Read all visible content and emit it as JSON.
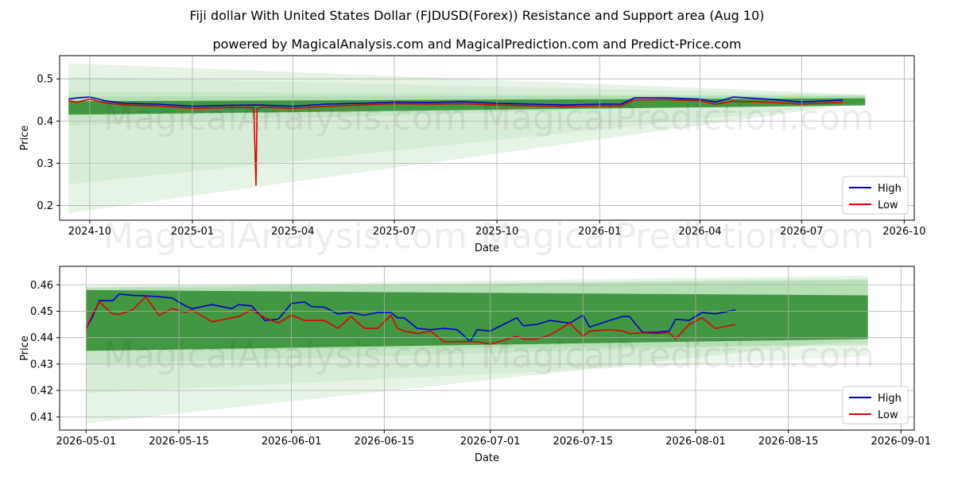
{
  "header": {
    "title": "Fiji dollar With United States Dollar (FJDUSD(Forex)) Resistance and Support area (Aug 10)",
    "subtitle": "powered by MagicalAnalysis.com and MagicalPrediction.com and Predict-Price.com"
  },
  "watermarks": [
    "MagicalAnalysis.com",
    "MagicalPrediction.com"
  ],
  "colors": {
    "high": "#0000cc",
    "low": "#dd0000",
    "band": "#2e8b2e",
    "fan": "#8fcf8f"
  },
  "chart_data": [
    {
      "type": "line",
      "xlabel": "Date",
      "ylabel": "Price",
      "xlim": [
        "2024-09-04",
        "2026-10-10"
      ],
      "ylim": [
        0.165,
        0.555
      ],
      "yticks": [
        0.2,
        0.3,
        0.4,
        0.5
      ],
      "xticks": [
        "2024-10",
        "2025-01",
        "2025-04",
        "2025-07",
        "2025-10",
        "2026-01",
        "2026-04",
        "2026-07",
        "2026-10"
      ],
      "legend": "lower-right",
      "grid": true,
      "series": [
        {
          "name": "High",
          "color": "#0000cc",
          "x": [
            "2024-09-12",
            "2024-09-20",
            "2024-10-01",
            "2024-10-15",
            "2024-11-01",
            "2024-12-01",
            "2025-01-01",
            "2025-02-01",
            "2025-03-01",
            "2025-04-01",
            "2025-05-01",
            "2025-06-01",
            "2025-07-01",
            "2025-08-01",
            "2025-09-01",
            "2025-10-01",
            "2025-11-01",
            "2025-12-01",
            "2026-01-01",
            "2026-01-20",
            "2026-02-01",
            "2026-03-01",
            "2026-04-01",
            "2026-04-15",
            "2026-05-01",
            "2026-06-01",
            "2026-07-01",
            "2026-08-07"
          ],
          "values": [
            0.452,
            0.455,
            0.457,
            0.448,
            0.442,
            0.44,
            0.435,
            0.437,
            0.438,
            0.435,
            0.44,
            0.442,
            0.445,
            0.444,
            0.446,
            0.442,
            0.44,
            0.438,
            0.44,
            0.44,
            0.455,
            0.455,
            0.452,
            0.445,
            0.457,
            0.452,
            0.445,
            0.45
          ]
        },
        {
          "name": "Low",
          "color": "#dd0000",
          "x": [
            "2024-09-12",
            "2024-09-20",
            "2024-10-01",
            "2024-10-15",
            "2024-11-01",
            "2024-12-01",
            "2025-01-01",
            "2025-02-01",
            "2025-02-25",
            "2025-02-27",
            "2025-02-28",
            "2025-03-05",
            "2025-04-01",
            "2025-05-01",
            "2025-06-01",
            "2025-07-01",
            "2025-08-01",
            "2025-09-01",
            "2025-10-01",
            "2025-11-01",
            "2025-12-01",
            "2026-01-01",
            "2026-01-20",
            "2026-02-01",
            "2026-03-01",
            "2026-04-01",
            "2026-04-15",
            "2026-05-01",
            "2026-06-01",
            "2026-07-01",
            "2026-08-07"
          ],
          "values": [
            0.448,
            0.445,
            0.452,
            0.443,
            0.438,
            0.436,
            0.43,
            0.432,
            0.432,
            0.248,
            0.43,
            0.433,
            0.43,
            0.435,
            0.438,
            0.441,
            0.44,
            0.441,
            0.438,
            0.436,
            0.434,
            0.436,
            0.436,
            0.45,
            0.451,
            0.448,
            0.44,
            0.447,
            0.445,
            0.44,
            0.445
          ]
        }
      ]
    },
    {
      "type": "line",
      "xlabel": "Date",
      "ylabel": "Price",
      "xlim": [
        "2026-04-27",
        "2026-09-03"
      ],
      "ylim": [
        0.405,
        0.467
      ],
      "yticks": [
        0.41,
        0.42,
        0.43,
        0.44,
        0.45,
        0.46
      ],
      "xticks": [
        "2026-05-01",
        "2026-05-15",
        "2026-06-01",
        "2026-06-15",
        "2026-07-01",
        "2026-07-15",
        "2026-08-01",
        "2026-08-15",
        "2026-09-01"
      ],
      "legend": "lower-right",
      "grid": true,
      "series": [
        {
          "name": "High",
          "color": "#0000cc",
          "x": [
            "2026-05-01",
            "2026-05-02",
            "2026-05-03",
            "2026-05-05",
            "2026-05-06",
            "2026-05-08",
            "2026-05-10",
            "2026-05-12",
            "2026-05-14",
            "2026-05-16",
            "2026-05-17",
            "2026-05-20",
            "2026-05-23",
            "2026-05-24",
            "2026-05-26",
            "2026-05-28",
            "2026-05-30",
            "2026-06-01",
            "2026-06-03",
            "2026-06-04",
            "2026-06-06",
            "2026-06-08",
            "2026-06-10",
            "2026-06-12",
            "2026-06-14",
            "2026-06-16",
            "2026-06-17",
            "2026-06-18",
            "2026-06-20",
            "2026-06-22",
            "2026-06-24",
            "2026-06-26",
            "2026-06-28",
            "2026-06-29",
            "2026-07-01",
            "2026-07-03",
            "2026-07-05",
            "2026-07-06",
            "2026-07-08",
            "2026-07-10",
            "2026-07-13",
            "2026-07-15",
            "2026-07-16",
            "2026-07-19",
            "2026-07-21",
            "2026-07-22",
            "2026-07-24",
            "2026-07-26",
            "2026-07-28",
            "2026-07-29",
            "2026-07-31",
            "2026-08-02",
            "2026-08-04",
            "2026-08-07"
          ],
          "values": [
            0.4435,
            0.448,
            0.454,
            0.454,
            0.4565,
            0.456,
            0.4558,
            0.4555,
            0.455,
            0.452,
            0.451,
            0.4525,
            0.451,
            0.4525,
            0.452,
            0.4465,
            0.447,
            0.453,
            0.4535,
            0.4518,
            0.4515,
            0.449,
            0.4495,
            0.4485,
            0.4495,
            0.4495,
            0.4475,
            0.4475,
            0.4435,
            0.443,
            0.4435,
            0.443,
            0.4385,
            0.443,
            0.4425,
            0.445,
            0.4475,
            0.4445,
            0.445,
            0.4465,
            0.4455,
            0.4485,
            0.444,
            0.4465,
            0.448,
            0.448,
            0.442,
            0.442,
            0.4425,
            0.447,
            0.4465,
            0.4495,
            0.449,
            0.4505
          ]
        },
        {
          "name": "Low",
          "color": "#dd0000",
          "x": [
            "2026-05-01",
            "2026-05-02",
            "2026-05-03",
            "2026-05-05",
            "2026-05-06",
            "2026-05-08",
            "2026-05-10",
            "2026-05-12",
            "2026-05-14",
            "2026-05-16",
            "2026-05-17",
            "2026-05-20",
            "2026-05-23",
            "2026-05-24",
            "2026-05-26",
            "2026-05-28",
            "2026-05-30",
            "2026-06-01",
            "2026-06-03",
            "2026-06-04",
            "2026-06-06",
            "2026-06-08",
            "2026-06-10",
            "2026-06-12",
            "2026-06-14",
            "2026-06-16",
            "2026-06-17",
            "2026-06-18",
            "2026-06-20",
            "2026-06-22",
            "2026-06-24",
            "2026-06-26",
            "2026-06-28",
            "2026-06-29",
            "2026-07-01",
            "2026-07-03",
            "2026-07-05",
            "2026-07-06",
            "2026-07-08",
            "2026-07-10",
            "2026-07-13",
            "2026-07-15",
            "2026-07-16",
            "2026-07-19",
            "2026-07-21",
            "2026-07-22",
            "2026-07-24",
            "2026-07-26",
            "2026-07-28",
            "2026-07-29",
            "2026-07-31",
            "2026-08-02",
            "2026-08-04",
            "2026-08-07"
          ],
          "values": [
            0.4435,
            0.449,
            0.4535,
            0.449,
            0.4488,
            0.4505,
            0.4555,
            0.4485,
            0.451,
            0.4495,
            0.4505,
            0.446,
            0.4475,
            0.448,
            0.4505,
            0.4475,
            0.4455,
            0.4485,
            0.4465,
            0.4465,
            0.4465,
            0.4435,
            0.448,
            0.4435,
            0.4435,
            0.4485,
            0.4435,
            0.4425,
            0.4415,
            0.4425,
            0.4385,
            0.4385,
            0.4385,
            0.4385,
            0.4375,
            0.439,
            0.4405,
            0.4395,
            0.4395,
            0.441,
            0.4455,
            0.4405,
            0.4425,
            0.443,
            0.4425,
            0.4415,
            0.4418,
            0.4415,
            0.4418,
            0.4395,
            0.445,
            0.4475,
            0.4435,
            0.445
          ]
        }
      ]
    }
  ]
}
